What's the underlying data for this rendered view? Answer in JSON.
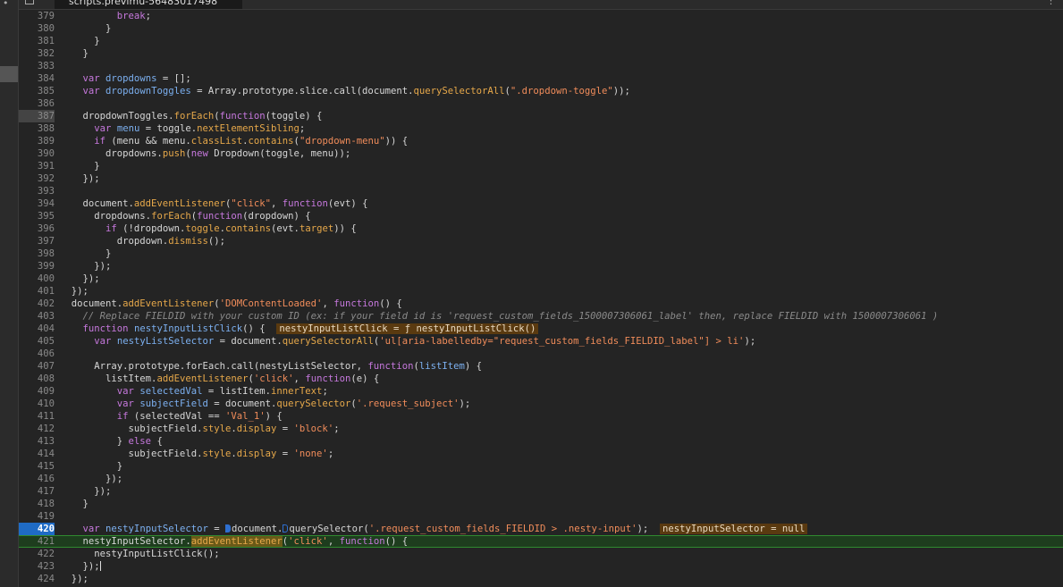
{
  "tab": {
    "title": "scripts.previmu-56483017498"
  },
  "colors": {
    "background": "#242424",
    "breakpoint": "#1f6bc5",
    "current_line": "#1e3d1e",
    "inline_value": "#5a3a10"
  },
  "lines": [
    {
      "n": "379",
      "cls": "",
      "html": "          <span class=\"k\">break</span>;"
    },
    {
      "n": "380",
      "cls": "",
      "html": "        }"
    },
    {
      "n": "381",
      "cls": "",
      "html": "      }"
    },
    {
      "n": "382",
      "cls": "",
      "html": "    }"
    },
    {
      "n": "383",
      "cls": "",
      "html": ""
    },
    {
      "n": "384",
      "cls": "",
      "html": "    <span class=\"k\">var</span> <span class=\"p\">dropdowns</span> = [];"
    },
    {
      "n": "385",
      "cls": "",
      "html": "    <span class=\"k\">var</span> <span class=\"p\">dropdownToggles</span> = Array.prototype.slice.call(document.<span class=\"f\">querySelectorAll</span>(<span class=\"s\">\".dropdown-toggle\"</span>));"
    },
    {
      "n": "386",
      "cls": "",
      "html": ""
    },
    {
      "n": "387",
      "cls": "fold",
      "html": "    dropdownToggles.<span class=\"f\">forEach</span>(<span class=\"k\">function</span>(toggle) {"
    },
    {
      "n": "388",
      "cls": "",
      "html": "      <span class=\"k\">var</span> <span class=\"p\">menu</span> = toggle.<span class=\"f\">nextElementSibling</span>;"
    },
    {
      "n": "389",
      "cls": "",
      "html": "      <span class=\"k\">if</span> (menu &amp;&amp; menu.<span class=\"f\">classList</span>.<span class=\"f\">contains</span>(<span class=\"s\">\"dropdown-menu\"</span>)) {"
    },
    {
      "n": "390",
      "cls": "",
      "html": "        dropdowns.<span class=\"f\">push</span>(<span class=\"k\">new</span> Dropdown(toggle, menu));"
    },
    {
      "n": "391",
      "cls": "",
      "html": "      }"
    },
    {
      "n": "392",
      "cls": "",
      "html": "    });"
    },
    {
      "n": "393",
      "cls": "",
      "html": ""
    },
    {
      "n": "394",
      "cls": "",
      "html": "    document.<span class=\"f\">addEventListener</span>(<span class=\"s\">\"click\"</span>, <span class=\"k\">function</span>(evt) {"
    },
    {
      "n": "395",
      "cls": "",
      "html": "      dropdowns.<span class=\"f\">forEach</span>(<span class=\"k\">function</span>(dropdown) {"
    },
    {
      "n": "396",
      "cls": "",
      "html": "        <span class=\"k\">if</span> (!dropdown.<span class=\"f\">toggle</span>.<span class=\"f\">contains</span>(evt.<span class=\"f\">target</span>)) {"
    },
    {
      "n": "397",
      "cls": "",
      "html": "          dropdown.<span class=\"f\">dismiss</span>();"
    },
    {
      "n": "398",
      "cls": "",
      "html": "        }"
    },
    {
      "n": "399",
      "cls": "",
      "html": "      });"
    },
    {
      "n": "400",
      "cls": "",
      "html": "    });"
    },
    {
      "n": "401",
      "cls": "",
      "html": "  });"
    },
    {
      "n": "402",
      "cls": "",
      "html": "  document.<span class=\"f\">addEventListener</span>(<span class=\"s\">'DOMContentLoaded'</span>, <span class=\"k\">function</span>() {"
    },
    {
      "n": "403",
      "cls": "",
      "html": "    <span class=\"c\">// Replace FIELDID with your custom ID (ex: if your field id is 'request_custom_fields_1500007306061_label' then, replace FIELDID with 1500007306061 )</span>"
    },
    {
      "n": "404",
      "cls": "",
      "html": "    <span class=\"k\">function</span> <span class=\"p\">nestyInputListClick</span>() {  <span class=\"inl\">nestyInputListClick = ƒ nestyInputListClick()</span>"
    },
    {
      "n": "405",
      "cls": "",
      "html": "      <span class=\"k\">var</span> <span class=\"p\">nestyListSelector</span> = document.<span class=\"f\">querySelectorAll</span>(<span class=\"s\">'ul[aria-labelledby=\"request_custom_fields_FIELDID_label\"] &gt; li'</span>);"
    },
    {
      "n": "406",
      "cls": "",
      "html": ""
    },
    {
      "n": "407",
      "cls": "",
      "html": "      Array.prototype.forEach.call(nestyListSelector, <span class=\"k\">function</span>(<span class=\"p\">listItem</span>) {"
    },
    {
      "n": "408",
      "cls": "",
      "html": "        listItem.<span class=\"f\">addEventListener</span>(<span class=\"s\">'click'</span>, <span class=\"k\">function</span>(e) {"
    },
    {
      "n": "409",
      "cls": "",
      "html": "          <span class=\"k\">var</span> <span class=\"p\">selectedVal</span> = listItem.<span class=\"f\">innerText</span>;"
    },
    {
      "n": "410",
      "cls": "",
      "html": "          <span class=\"k\">var</span> <span class=\"p\">subjectField</span> = document.<span class=\"f\">querySelector</span>(<span class=\"s\">'.request_subject'</span>);"
    },
    {
      "n": "411",
      "cls": "",
      "html": "          <span class=\"k\">if</span> (selectedVal == <span class=\"s\">'Val_1'</span>) {"
    },
    {
      "n": "412",
      "cls": "",
      "html": "            subjectField.<span class=\"f\">style</span>.<span class=\"f\">display</span> = <span class=\"s\">'block'</span>;"
    },
    {
      "n": "413",
      "cls": "",
      "html": "          } <span class=\"k\">else</span> {"
    },
    {
      "n": "414",
      "cls": "",
      "html": "            subjectField.<span class=\"f\">style</span>.<span class=\"f\">display</span> = <span class=\"s\">'none'</span>;"
    },
    {
      "n": "415",
      "cls": "",
      "html": "          }"
    },
    {
      "n": "416",
      "cls": "",
      "html": "        });"
    },
    {
      "n": "417",
      "cls": "",
      "html": "      });"
    },
    {
      "n": "418",
      "cls": "",
      "html": "    }"
    },
    {
      "n": "419",
      "cls": "",
      "html": ""
    },
    {
      "n": "420",
      "cls": "bp",
      "html": "    <span class=\"k\">var</span> <span class=\"p\">nestyInputSelector</span> = <span class=\"bpm\"></span>document.<span class=\"bpo\"></span>querySelector(<span class=\"s\">'.request_custom_fields_FIELDID &gt; .nesty-input'</span>);  <span class=\"inl\">nestyInputSelector = null</span>"
    },
    {
      "n": "421",
      "cls": "cur",
      "html": "    nestyInputSelector.<span class=\"f hlw\">addEventListener</span>(<span class=\"s\">'click'</span>, <span class=\"k\">function</span>() {"
    },
    {
      "n": "422",
      "cls": "",
      "html": "      nestyInputListClick();"
    },
    {
      "n": "423",
      "cls": "",
      "html": "    });<span class=\"caret\"></span>"
    },
    {
      "n": "424",
      "cls": "",
      "html": "  });"
    }
  ]
}
